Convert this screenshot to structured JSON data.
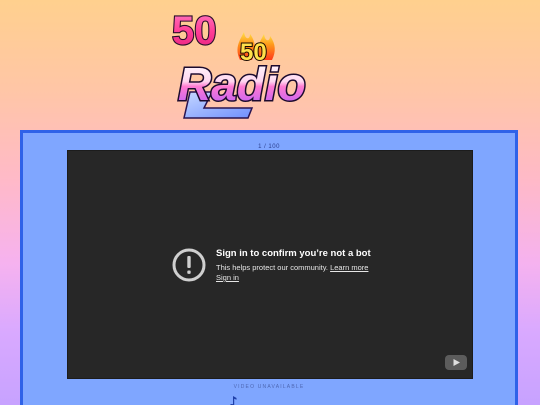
{
  "logo": {
    "number_main": "50",
    "number_small": "50",
    "word": "Radio"
  },
  "player": {
    "counter": "1 / 100",
    "error_title": "Sign in to confirm you’re not a bot",
    "error_text": "This helps protect our community.",
    "learn_more": "Learn more",
    "sign_in": "Sign in",
    "status": "VIDEO UNAVAILABLE"
  },
  "icons": {
    "error": "alert-circle-icon",
    "youtube": "youtube-play-icon",
    "note": "music-note-icon"
  },
  "colors": {
    "panel_border": "#2f62e8",
    "panel_bg": "#7fa6ff",
    "video_bg": "#272727",
    "logo_pink": "#ff4fa0",
    "logo_flame": "#ff7a1a"
  }
}
